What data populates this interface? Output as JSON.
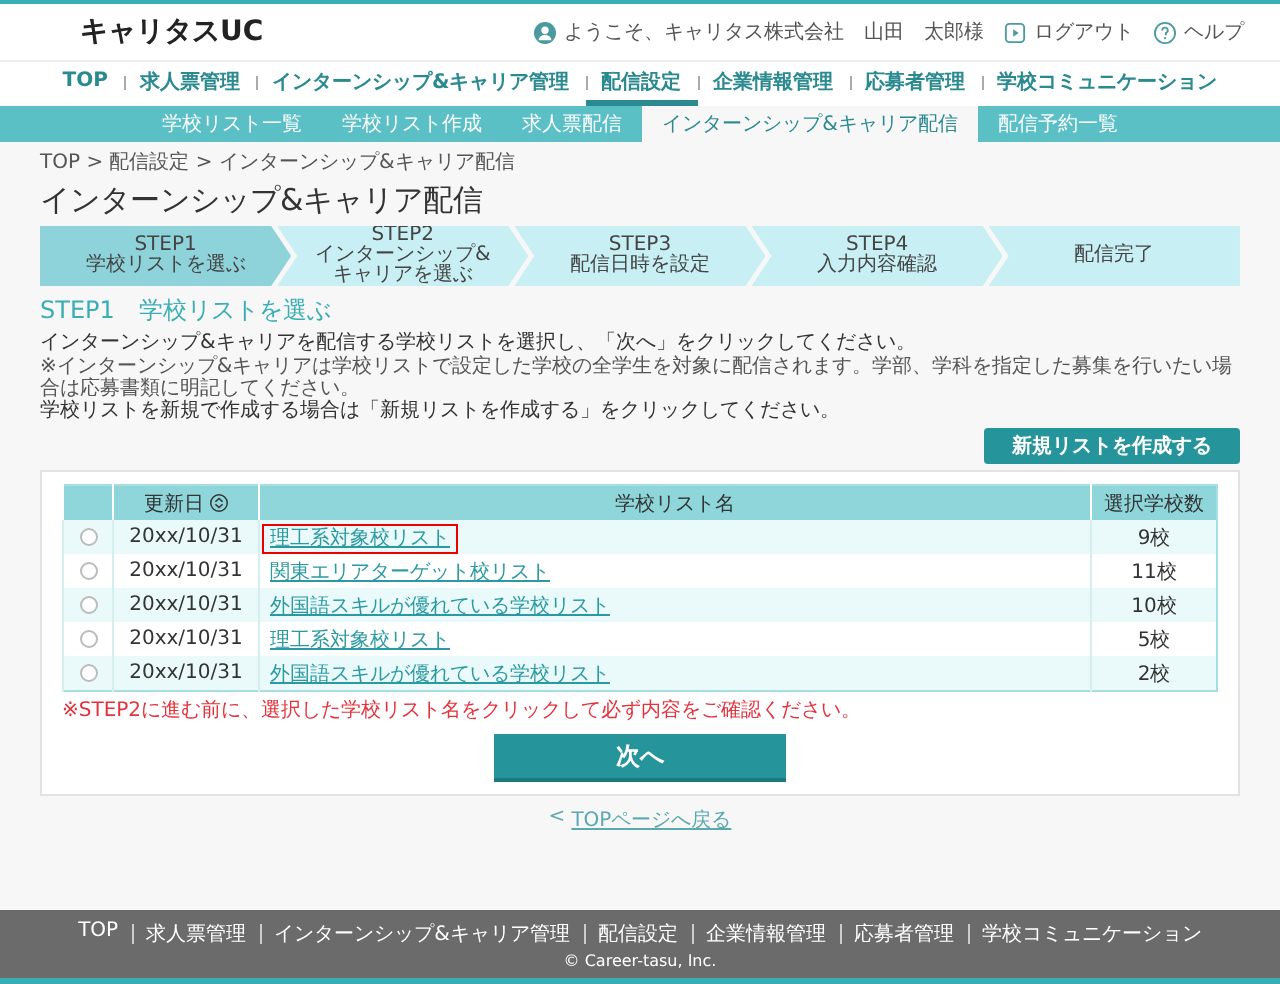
{
  "header": {
    "logo": "キャリタスUC",
    "greeting": "ようこそ、キャリタス株式会社　山田　太郎様",
    "logout": "ログアウト",
    "help": "ヘルプ"
  },
  "main_nav": [
    {
      "label": "TOP",
      "selected": false
    },
    {
      "label": "求人票管理",
      "selected": false
    },
    {
      "label": "インターンシップ&キャリア管理",
      "selected": false
    },
    {
      "label": "配信設定",
      "selected": true
    },
    {
      "label": "企業情報管理",
      "selected": false
    },
    {
      "label": "応募者管理",
      "selected": false
    },
    {
      "label": "学校コミュニケーション",
      "selected": false
    }
  ],
  "sub_nav": [
    {
      "label": "学校リスト一覧",
      "selected": false
    },
    {
      "label": "学校リスト作成",
      "selected": false
    },
    {
      "label": "求人票配信",
      "selected": false
    },
    {
      "label": "インターンシップ&キャリア配信",
      "selected": true
    },
    {
      "label": "配信予約一覧",
      "selected": false
    }
  ],
  "breadcrumb": "TOP > 配信設定 > インターンシップ&キャリア配信",
  "page_title": "インターンシップ&キャリア配信",
  "steps": [
    {
      "lines": [
        "STEP1",
        "学校リストを選ぶ"
      ],
      "selected": true
    },
    {
      "lines": [
        "STEP2",
        "インターンシップ&",
        "キャリアを選ぶ"
      ],
      "selected": false
    },
    {
      "lines": [
        "STEP3",
        "配信日時を設定"
      ],
      "selected": false
    },
    {
      "lines": [
        "STEP4",
        "入力内容確認"
      ],
      "selected": false
    },
    {
      "lines": [
        "配信完了"
      ],
      "selected": false
    }
  ],
  "section_heading": "STEP1　学校リストを選ぶ",
  "instructions": [
    {
      "kind": "normal",
      "text": "インターンシップ&キャリアを配信する学校リストを選択し、「次へ」をクリックしてください。"
    },
    {
      "kind": "note",
      "text": "※インターンシップ&キャリアは学校リストで設定した学校の全学生を対象に配信されます。学部、学科を指定した募集を行いたい場合は応募書類に明記してください。"
    },
    {
      "kind": "normal",
      "text": "学校リストを新規で作成する場合は「新規リストを作成する」をクリックしてください。"
    }
  ],
  "new_list_button": "新規リストを作成する",
  "table": {
    "columns": [
      "更新日",
      "学校リスト名",
      "選択学校数"
    ],
    "rows": [
      {
        "selected": false,
        "highlighted": true,
        "date": "20xx/10/31",
        "name": "理工系対象校リスト",
        "count": "9校"
      },
      {
        "selected": false,
        "highlighted": false,
        "date": "20xx/10/31",
        "name": "関東エリアターゲット校リスト",
        "count": "11校"
      },
      {
        "selected": false,
        "highlighted": false,
        "date": "20xx/10/31",
        "name": "外国語スキルが優れている学校リスト",
        "count": "10校"
      },
      {
        "selected": false,
        "highlighted": false,
        "date": "20xx/10/31",
        "name": "理工系対象校リスト",
        "count": "5校"
      },
      {
        "selected": false,
        "highlighted": false,
        "date": "20xx/10/31",
        "name": "外国語スキルが優れている学校リスト",
        "count": "2校"
      }
    ]
  },
  "warning": "※STEP2に進む前に、選択した学校リスト名をクリックして必ず内容をご確認ください。",
  "next_button": "次へ",
  "back_link": {
    "arrow": "<",
    "label": "TOPページへ戻る"
  },
  "footer": {
    "links": [
      "TOP",
      "求人票管理",
      "インターンシップ&キャリア管理",
      "配信設定",
      "企業情報管理",
      "応募者管理",
      "学校コミュニケーション"
    ],
    "copyright": "© Career-tasu, Inc."
  }
}
